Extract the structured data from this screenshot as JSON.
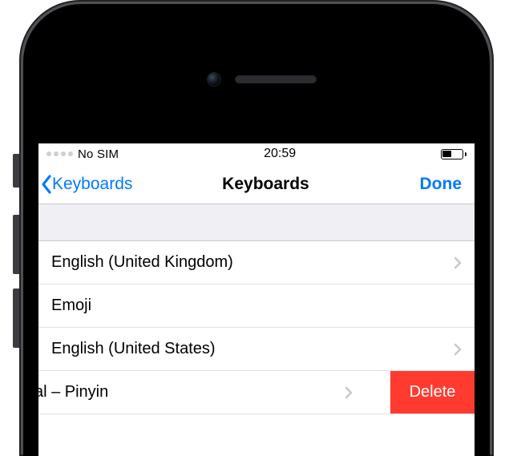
{
  "status": {
    "carrier": "No SIM",
    "time": "20:59"
  },
  "nav": {
    "back_label": "Keyboards",
    "title": "Keyboards",
    "done_label": "Done"
  },
  "rows": {
    "r0": {
      "label": "English (United Kingdom)"
    },
    "r1": {
      "label": "Emoji"
    },
    "r2": {
      "label": "English (United States)"
    },
    "r3": {
      "label": "e, Traditional – Pinyin"
    }
  },
  "delete_label": "Delete"
}
